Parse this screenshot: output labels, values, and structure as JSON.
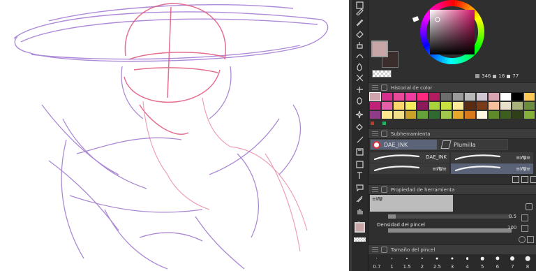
{
  "color": {
    "main": "#c8a6a8",
    "sub": "#3a2d2c",
    "r": "346",
    "g": "16",
    "b": "77",
    "wheel_selected": "#e04a8a"
  },
  "color_history": {
    "title": "Historial de color",
    "rows": [
      [
        "#d1a4ad",
        "#d62f8e",
        "#e84a9a",
        "#f23ba0",
        "#ff2a7f",
        "#b21c60",
        "#6d6d6d",
        "#9b9b9b",
        "#b8b8b8",
        "#cfc6d2",
        "#d8a5b0",
        "#ffffff",
        "#000000",
        "#ffc857"
      ],
      [
        "#c02277",
        "#e55fa8",
        "#ffd66b",
        "#f4ec5a",
        "#8a1a5a",
        "#a8d33b",
        "#c8e040",
        "#ffeb99",
        "#5b2a12",
        "#7a3c18",
        "#f6c09b",
        "#e8e0c8",
        "#a8b27a",
        "#6a8e3d"
      ],
      [
        "#8e3b88",
        "#fde88d",
        "#f3e08b",
        "#c9a227",
        "#66a13a",
        "#2f6b31",
        "#a2c84b",
        "#e7a729",
        "#d87a1b",
        "#fff7e0",
        "#5e8a2a",
        "#3d5f1d",
        "#2f3f18",
        "#83b13a"
      ]
    ]
  },
  "sub_tool": {
    "title": "Subherramienta",
    "tabs": [
      "DAE_INK",
      "Plumilla"
    ],
    "brushes": [
      "DAE_INK",
      "≡ⵍⰯ≡",
      "≡ⵍⰯ≡",
      "≡ⵍⰯ≡"
    ]
  },
  "tool_property": {
    "title": "Propiedad de herramienta",
    "preset_name": "≡ⵍⰯ",
    "value_1": "0.5",
    "density_label": "Densidad del pincel",
    "density_value": "100"
  },
  "brush_size": {
    "title": "Tamaño del pincel",
    "sizes": [
      "0.7",
      "1",
      "1.5",
      "2",
      "2.5",
      "3",
      "4",
      "5",
      "6",
      "7",
      "8"
    ],
    "dot_levels": [
      0.07,
      0.1,
      0.15,
      0.2,
      0.25,
      0.3,
      0.4,
      0.5,
      0.6,
      0.7,
      0.8
    ]
  },
  "tools": [
    "select-tool-icon",
    "pen-tool-icon",
    "pencil-tool-icon",
    "eraser-tool-icon",
    "fill-tool-icon",
    "blend-tool-icon",
    "airbrush-tool-icon",
    "decoration-tool-icon",
    "move-layer-icon",
    "lasso-icon",
    "magic-wand-icon",
    "fill-bucket-icon",
    "eyedropper-icon",
    "figure-tool-icon",
    "frame-tool-icon",
    "text-tool-icon",
    "balloon-tool-icon",
    "ruler-tool-icon",
    "hand-tool-icon",
    "zoom-tool-icon"
  ]
}
